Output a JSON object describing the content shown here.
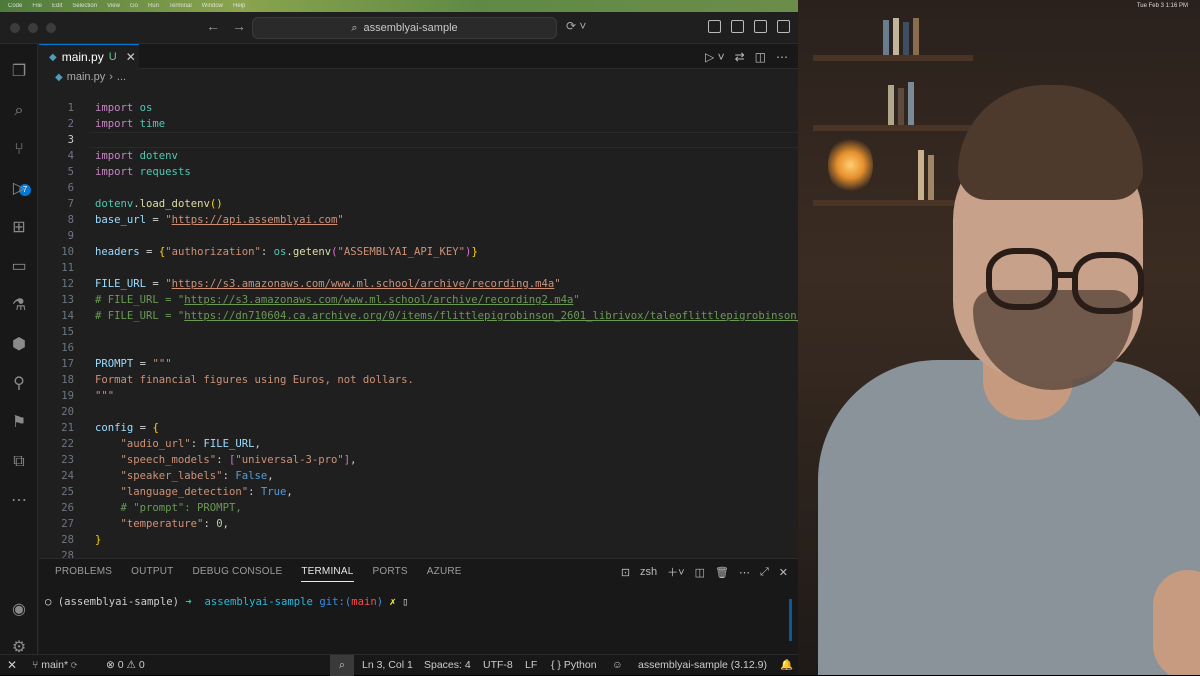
{
  "menubar": {
    "items": [
      "Code",
      "File",
      "Edit",
      "Selection",
      "View",
      "Go",
      "Run",
      "Terminal",
      "Window",
      "Help"
    ],
    "clock": "Tue Feb 3  1:16 PM"
  },
  "titlebar": {
    "search_text": "assemblyai-sample"
  },
  "tab": {
    "file": "main.py",
    "status": "U"
  },
  "breadcrumb": {
    "file": "main.py",
    "more": "..."
  },
  "editor": {
    "current_line": 3,
    "lines": [
      "1",
      "2",
      "3",
      "4",
      "5",
      "6",
      "7",
      "8",
      "9",
      "10",
      "11",
      "12",
      "13",
      "14",
      "15",
      "16",
      "17",
      "18",
      "19",
      "20",
      "21",
      "22",
      "23",
      "24",
      "25",
      "26",
      "27",
      "28"
    ]
  },
  "panel": {
    "tabs": [
      "PROBLEMS",
      "OUTPUT",
      "DEBUG CONSOLE",
      "TERMINAL",
      "PORTS",
      "AZURE"
    ],
    "active_tab": "TERMINAL",
    "shell": "zsh",
    "prompt": {
      "env": "(assemblyai-sample)",
      "arrow": "➜",
      "dir": "assemblyai-sample",
      "git": "git:(",
      "branch": "main",
      "git_close": ")",
      "dirty": "✗"
    }
  },
  "status": {
    "branch": "main*",
    "errors": "0",
    "warnings": "0",
    "position": "Ln 3, Col 1",
    "spaces": "Spaces: 4",
    "encoding": "UTF-8",
    "eol": "LF",
    "language": "Python",
    "interpreter": "assemblyai-sample (3.12.9)"
  },
  "activity_badge": "7",
  "colors": {
    "accent": "#0078d4",
    "background": "#1f1f1f",
    "sidebar": "#181818"
  }
}
